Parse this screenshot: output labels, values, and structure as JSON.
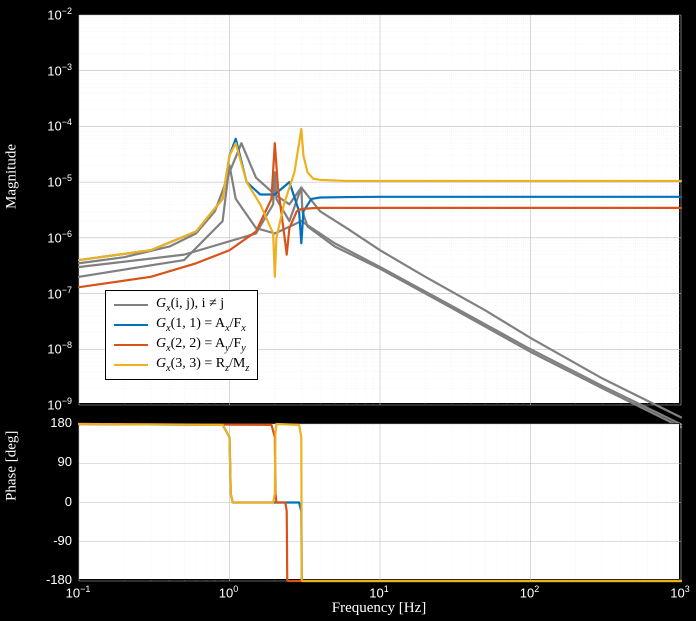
{
  "chart_data": [
    {
      "type": "line",
      "title": "",
      "xlabel": "Frequency [Hz]",
      "ylabel": "Magnitude",
      "xscale": "log",
      "yscale": "log",
      "xlim": [
        0.1,
        1000
      ],
      "ylim_exp": [
        -9,
        -2
      ],
      "yticks_exp": [
        -9,
        -8,
        -7,
        -6,
        -5,
        -4,
        -3,
        -2
      ],
      "legend": {
        "items": [
          {
            "label": "G_x(i,j),  i ≠ j",
            "color": "#808080"
          },
          {
            "label": "G_x(1,1) = A_x / F_x",
            "color": "#0072bd"
          },
          {
            "label": "G_x(2,2) = A_y / F_y",
            "color": "#d95319"
          },
          {
            "label": "G_x(3,3) = R_z / M_z",
            "color": "#edb120"
          }
        ]
      },
      "series": [
        {
          "name": "G_x(i,j) offdiag (various)",
          "color": "#808080",
          "x": [
            0.1,
            0.2,
            0.4,
            0.6,
            0.8,
            1.0,
            1.2,
            1.5,
            2.0,
            2.5,
            3.0,
            4.0,
            6.0,
            10,
            20,
            50,
            100,
            300,
            1000
          ],
          "y": [
            3.5e-07,
            4.5e-07,
            7e-07,
            1.2e-06,
            3e-06,
            1.5e-05,
            5e-05,
            1.2e-05,
            6e-06,
            4e-06,
            8e-06,
            3e-06,
            1.5e-06,
            6e-07,
            2e-07,
            5e-08,
            1.6e-08,
            3e-09,
            6e-10
          ]
        },
        {
          "name": "G_x(1,1)",
          "color": "#0072bd",
          "x": [
            0.1,
            0.3,
            0.6,
            0.9,
            1.0,
            1.1,
            1.3,
            1.6,
            2.0,
            2.5,
            2.9,
            3.0,
            3.1,
            3.5,
            4.0,
            6.0,
            10,
            30,
            100,
            300,
            1000
          ],
          "y": [
            4e-07,
            6e-07,
            1.3e-06,
            5e-06,
            3e-05,
            6e-05,
            1e-05,
            6e-06,
            6e-06,
            1e-05,
            3e-06,
            8e-07,
            3e-06,
            5e-06,
            5.3e-06,
            5.4e-06,
            5.45e-06,
            5.45e-06,
            5.45e-06,
            5.45e-06,
            5.45e-06
          ]
        },
        {
          "name": "G_x(2,2)",
          "color": "#d95319",
          "x": [
            0.1,
            0.3,
            0.6,
            1.0,
            1.5,
            1.9,
            2.0,
            2.1,
            2.35,
            2.4,
            2.5,
            2.8,
            3.0,
            3.5,
            4.0,
            6.0,
            10,
            30,
            100,
            300,
            1000
          ],
          "y": [
            1.3e-07,
            2e-07,
            3.5e-07,
            6e-07,
            1.3e-06,
            5e-06,
            5e-05,
            8e-06,
            8e-07,
            5e-07,
            1.5e-06,
            3e-06,
            3.3e-06,
            3.4e-06,
            3.45e-06,
            3.45e-06,
            3.45e-06,
            3.45e-06,
            3.45e-06,
            3.45e-06,
            3.45e-06
          ]
        },
        {
          "name": "G_x(3,3)",
          "color": "#edb120",
          "x": [
            0.1,
            0.3,
            0.6,
            0.9,
            1.0,
            1.1,
            1.3,
            1.6,
            1.95,
            2.0,
            2.05,
            2.3,
            2.7,
            2.9,
            3.0,
            3.1,
            3.3,
            3.6,
            4.0,
            6.0,
            10,
            30,
            100,
            300,
            1000
          ],
          "y": [
            4e-07,
            6e-07,
            1.3e-06,
            5e-06,
            3e-05,
            5e-05,
            1e-05,
            4e-06,
            1.2e-06,
            2e-07,
            1e-06,
            4e-06,
            1.5e-05,
            5e-05,
            9e-05,
            3e-05,
            1.5e-05,
            1.15e-05,
            1.1e-05,
            1.05e-05,
            1.05e-05,
            1.05e-05,
            1.05e-05,
            1.05e-05,
            1.05e-05
          ]
        }
      ]
    },
    {
      "type": "line",
      "title": "",
      "xlabel": "Frequency [Hz]",
      "ylabel": "Phase [deg]",
      "xscale": "log",
      "yscale": "linear",
      "xlim": [
        0.1,
        1000
      ],
      "ylim": [
        -180,
        180
      ],
      "yticks": [
        -180,
        -90,
        0,
        90,
        180
      ],
      "series": [
        {
          "name": "G_x(1,1)",
          "color": "#0072bd",
          "x": [
            0.1,
            0.9,
            1.0,
            1.02,
            1.05,
            2.9,
            3.0,
            3.02,
            3.05,
            1000
          ],
          "y": [
            180,
            178,
            150,
            20,
            0,
            0,
            -20,
            -178,
            -180,
            -180
          ]
        },
        {
          "name": "G_x(2,2)",
          "color": "#d95319",
          "x": [
            0.1,
            1.9,
            2.0,
            2.02,
            2.05,
            2.35,
            2.4,
            2.42,
            2.45,
            1000
          ],
          "y": [
            180,
            178,
            150,
            20,
            0,
            0,
            -20,
            -178,
            -180,
            -180
          ]
        },
        {
          "name": "G_x(3,3)",
          "color": "#edb120",
          "x": [
            0.1,
            0.9,
            1.0,
            1.02,
            1.05,
            1.95,
            2.0,
            2.02,
            2.05,
            2.9,
            3.0,
            3.02,
            3.05,
            1000
          ],
          "y": [
            180,
            178,
            150,
            20,
            0,
            0,
            20,
            160,
            180,
            178,
            150,
            -178,
            -180,
            -180
          ]
        }
      ]
    }
  ],
  "labels": {
    "magnitude": "Magnitude",
    "phase": "Phase [deg]",
    "freq": "Frequency [Hz]"
  },
  "legend_text": {
    "row0_a": "G",
    "row0_b": "x",
    "row0_c": "(i, j),  i ≠ j",
    "row1_a": "G",
    "row1_b": "x",
    "row1_c": "(1, 1) = A",
    "row1_d": "x",
    "row1_e": "/F",
    "row1_f": "x",
    "row2_a": "G",
    "row2_b": "x",
    "row2_c": "(2, 2) = A",
    "row2_d": "y",
    "row2_e": "/F",
    "row2_f": "y",
    "row3_a": "G",
    "row3_b": "x",
    "row3_c": "(3, 3) = R",
    "row3_d": "z",
    "row3_e": "/M",
    "row3_f": "z"
  },
  "xticks": {
    "t0": "10",
    "t0e": "−1",
    "t1": "10",
    "t1e": "0",
    "t2": "10",
    "t2e": "1",
    "t3": "10",
    "t3e": "2",
    "t4": "10",
    "t4e": "3"
  },
  "yticks_mag": {
    "m2": "10",
    "m2e": "−2",
    "m3": "10",
    "m3e": "−3",
    "m4": "10",
    "m4e": "−4",
    "m5": "10",
    "m5e": "−5",
    "m6": "10",
    "m6e": "−6",
    "m7": "10",
    "m7e": "−7",
    "m8": "10",
    "m8e": "−8",
    "m9": "10",
    "m9e": "−9"
  },
  "yticks_ph": {
    "p180": "180",
    "p90": "90",
    "p0": "0",
    "n90": "-90",
    "n180": "-180"
  }
}
